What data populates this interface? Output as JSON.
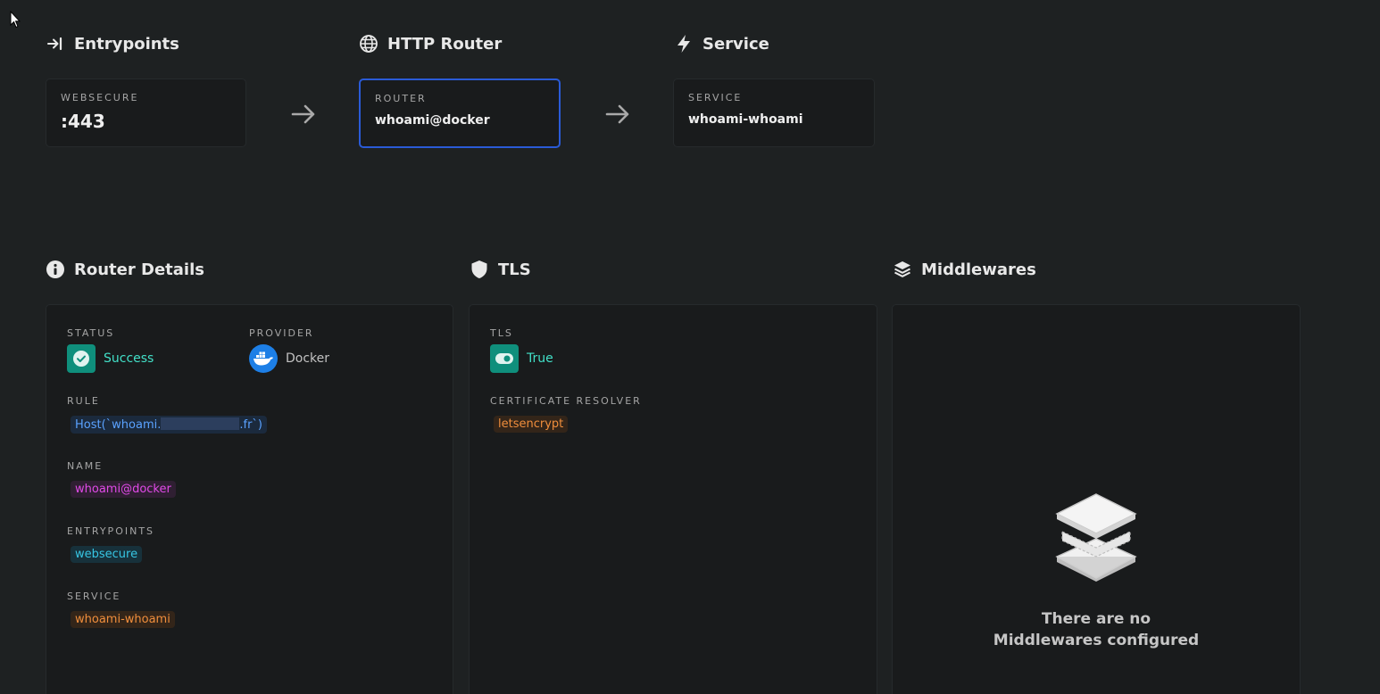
{
  "sections": {
    "entrypoints": {
      "title": "Entrypoints",
      "icon": "sign-in-icon"
    },
    "http_router": {
      "title": "HTTP Router",
      "icon": "globe-icon"
    },
    "service": {
      "title": "Service",
      "icon": "lightning-bolt-icon"
    },
    "router_details": {
      "title": "Router Details",
      "icon": "info-icon"
    },
    "tls": {
      "title": "TLS",
      "icon": "shield-icon"
    },
    "middlewares": {
      "title": "Middlewares",
      "icon": "layers-icon"
    }
  },
  "flow": {
    "entrypoint": {
      "label": "WEBSECURE",
      "value": ":443"
    },
    "router": {
      "label": "ROUTER",
      "value": "whoami@docker"
    },
    "service": {
      "label": "SERVICE",
      "value": "whoami-whoami"
    }
  },
  "router_details": {
    "status_label": "STATUS",
    "status_value": "Success",
    "provider_label": "PROVIDER",
    "provider_value": "Docker",
    "rule_label": "RULE",
    "rule_prefix": "Host(`whoami.",
    "rule_suffix": ".fr`)",
    "name_label": "NAME",
    "name_value": "whoami@docker",
    "entrypoints_label": "ENTRYPOINTS",
    "entrypoints_value": "websecure",
    "service_label": "SERVICE",
    "service_value": "whoami-whoami"
  },
  "tls": {
    "tls_label": "TLS",
    "tls_value": "True",
    "resolver_label": "CERTIFICATE RESOLVER",
    "resolver_value": "letsencrypt"
  },
  "middlewares": {
    "empty_line1": "There are no",
    "empty_line2": "Middlewares configured"
  },
  "colors": {
    "background": "#1e2122",
    "card": "#191b1c",
    "active_border": "#2a5bd7",
    "success": "#42e0c8",
    "docker": "#1d7fe6"
  }
}
